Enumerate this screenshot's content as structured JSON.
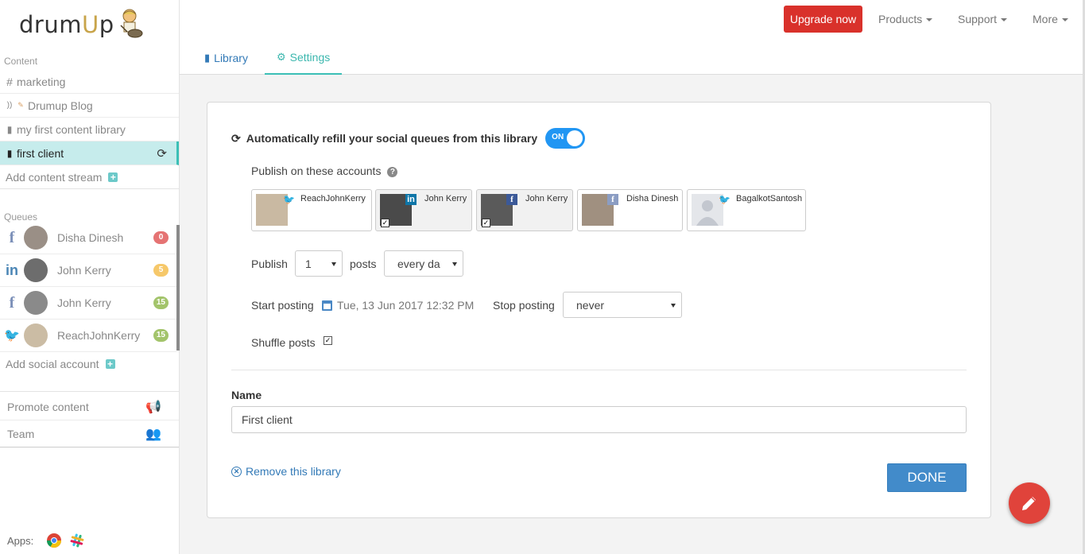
{
  "brand": {
    "logo_prefix": "drum",
    "logo_accent": "U",
    "logo_suffix": "p"
  },
  "sidebar": {
    "content_label": "Content",
    "content_items": [
      {
        "icon": "#",
        "label": "marketing"
      },
      {
        "icon": "rss",
        "label": "Drumup Blog"
      },
      {
        "icon": "bookmark",
        "label": "my first content library"
      },
      {
        "icon": "bookmark",
        "label": "first client",
        "active": true
      }
    ],
    "add_stream": "Add content stream",
    "queues_label": "Queues",
    "queues": [
      {
        "network": "facebook",
        "name": "Disha Dinesh",
        "count": "0",
        "badge_color": "#e57373"
      },
      {
        "network": "linkedin",
        "name": "John Kerry",
        "count": "5",
        "badge_color": "#f6c86a"
      },
      {
        "network": "facebook",
        "name": "John Kerry",
        "count": "15",
        "badge_color": "#a3c46b"
      },
      {
        "network": "twitter",
        "name": "ReachJohnKerry",
        "count": "15",
        "badge_color": "#a3c46b"
      }
    ],
    "add_social": "Add social account",
    "promote": "Promote content",
    "team": "Team",
    "apps_label": "Apps:"
  },
  "topbar": {
    "upgrade": "Upgrade now",
    "products": "Products",
    "support": "Support",
    "more": "More",
    "tab_library": "Library",
    "tab_settings": "Settings"
  },
  "settings": {
    "refill_label": "Automatically refill your social queues from this library",
    "toggle_label": "ON",
    "publish_accounts_label": "Publish on these accounts",
    "accounts": [
      {
        "name": "ReachJohnKerry",
        "network": "twitter",
        "selected": false
      },
      {
        "name": "John Kerry",
        "network": "linkedin",
        "selected": true
      },
      {
        "name": "John Kerry",
        "network": "facebook",
        "selected": true
      },
      {
        "name": "Disha Dinesh",
        "network": "facebook",
        "selected": false
      },
      {
        "name": "BagalkotSantosh",
        "network": "twitter",
        "selected": false
      }
    ],
    "publish_label": "Publish",
    "publish_count": "1",
    "posts_label": "posts",
    "frequency": "every day",
    "start_label": "Start posting",
    "start_date": "Tue, 13 Jun 2017 12:32 PM",
    "stop_label": "Stop posting",
    "stop_value": "never",
    "shuffle_label": "Shuffle posts",
    "shuffle_checked": true,
    "name_label": "Name",
    "name_value": "First client",
    "remove_label": "Remove this library",
    "done_label": "DONE"
  },
  "colors": {
    "accent": "#3bbfb6",
    "upgrade": "#d9312b",
    "done": "#428bca",
    "fab": "#e0433b",
    "toggle": "#2196f3"
  }
}
